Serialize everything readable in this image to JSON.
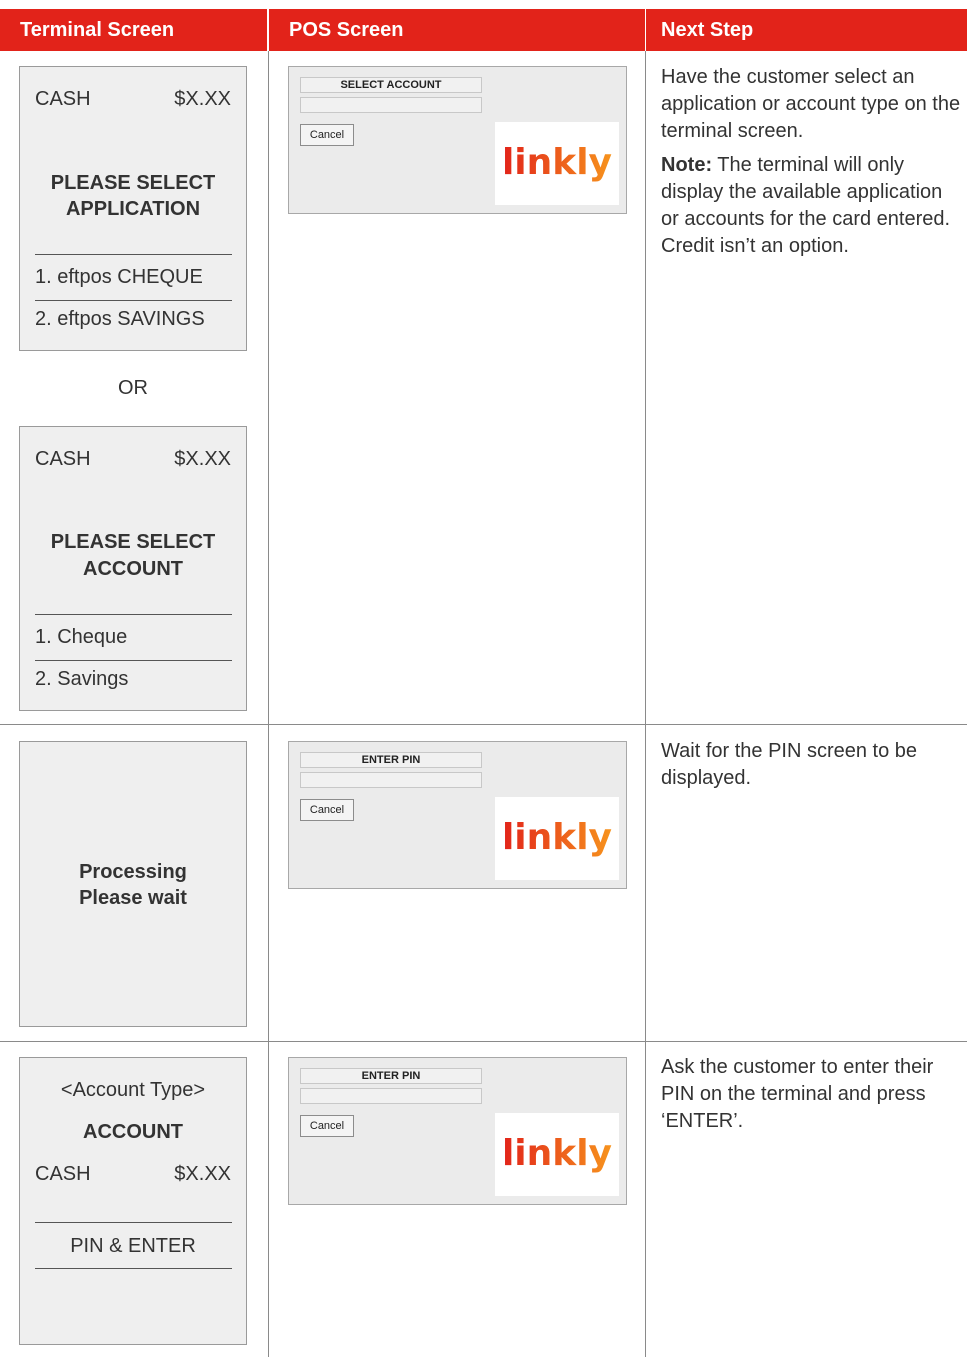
{
  "headers": {
    "terminal": "Terminal Screen",
    "pos": "POS Screen",
    "next": "Next Step"
  },
  "row1": {
    "terminal_a": {
      "cash_label": "CASH",
      "amount": "$X.XX",
      "prompt_line1": "PLEASE SELECT",
      "prompt_line2": "APPLICATION",
      "option1": "1. eftpos CHEQUE",
      "option2": "2. eftpos SAVINGS"
    },
    "or_label": "OR",
    "terminal_b": {
      "cash_label": "CASH",
      "amount": "$X.XX",
      "prompt_line1": "PLEASE SELECT",
      "prompt_line2": "ACCOUNT",
      "option1": "1. Cheque",
      "option2": "2. Savings"
    },
    "pos": {
      "title": "SELECT ACCOUNT",
      "cancel": "Cancel",
      "logo": "linkly"
    },
    "next_step": {
      "text": "Have the customer select an application or account type on the terminal screen.",
      "note_label": "Note:",
      "note_text": " The terminal will only display the available application or accounts for the card entered. Credit isn’t an option."
    }
  },
  "row2": {
    "terminal": {
      "line1": "Processing",
      "line2": "Please wait"
    },
    "pos": {
      "title": "ENTER PIN",
      "cancel": "Cancel",
      "logo": "linkly"
    },
    "next_step": {
      "text": "Wait for the PIN screen to be displayed."
    }
  },
  "row3": {
    "terminal": {
      "account_type": "<Account Type>",
      "account_label": "ACCOUNT",
      "cash_label": "CASH",
      "amount": "$X.XX",
      "pin_prompt": "PIN & ENTER"
    },
    "pos": {
      "title": "ENTER PIN",
      "cancel": "Cancel",
      "logo": "linkly"
    },
    "next_step": {
      "text": "Ask the customer to enter their PIN on the terminal and press ‘ENTER’."
    }
  },
  "colors": {
    "header_red": "#e2231a",
    "logo_gradient": [
      "#e2231a",
      "#f7941d"
    ]
  }
}
